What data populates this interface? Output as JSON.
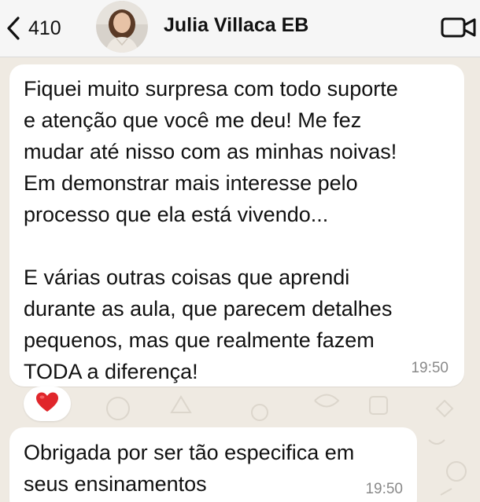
{
  "header": {
    "back_count": "410",
    "contact_name": "Julia Villaca EB",
    "back_icon": "chevron-left-icon",
    "video_icon": "video-camera-icon"
  },
  "messages": [
    {
      "text": "Fiquei muito surpresa com todo suporte\ne atenção que você me deu! Me fez\nmudar até nisso com as minhas noivas!\nEm demonstrar mais interesse pelo\nprocesso que ela está vivendo...\n\nE várias outras coisas que aprendi\ndurante as aula, que parecem detalhes\npequenos, mas que realmente fazem\nTODA a diferença!",
      "time": "19:50",
      "reaction": "❤️"
    },
    {
      "text": "Obrigada por ser tão especifica em\nseus ensinamentos",
      "time": "19:50"
    }
  ],
  "colors": {
    "chat_background": "#efeae2",
    "bubble": "#ffffff",
    "header": "#f6f6f6",
    "timestamp": "#8a8a8a",
    "heart": "#e0262b"
  }
}
